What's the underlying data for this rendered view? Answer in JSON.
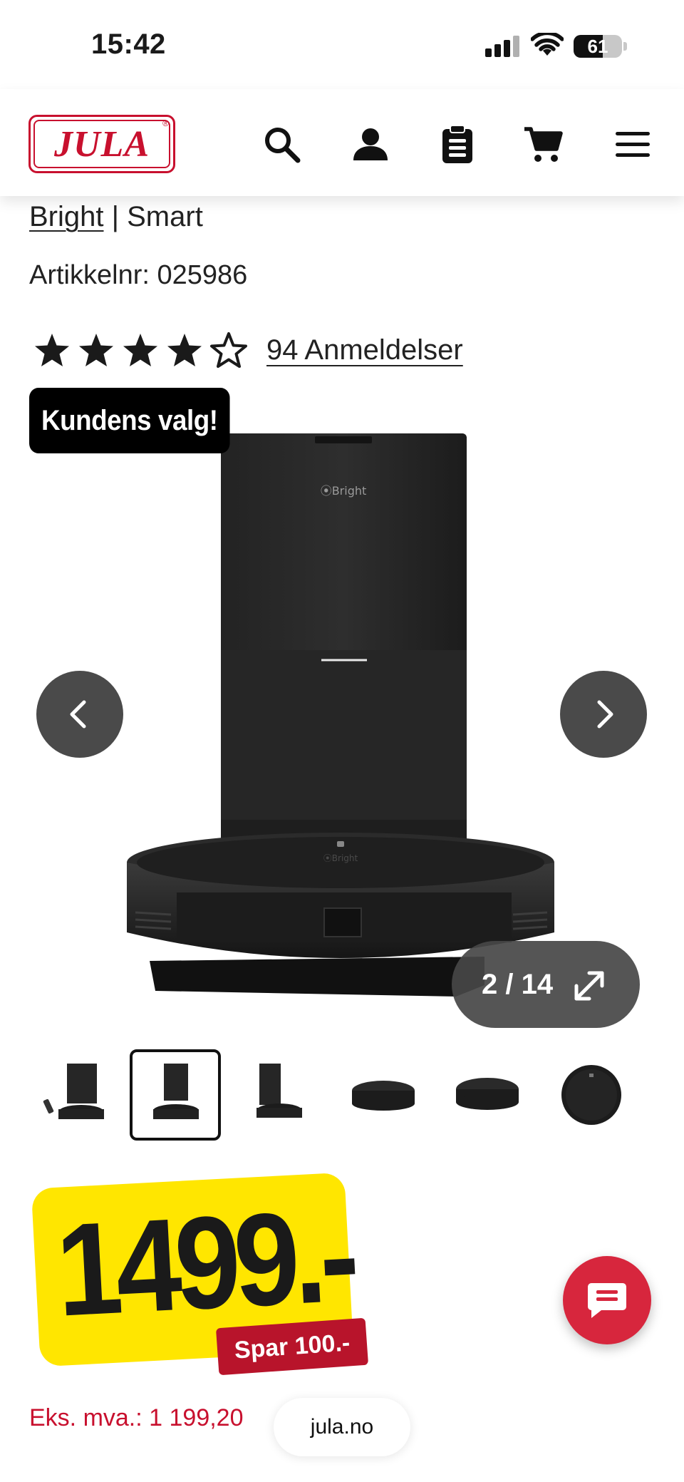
{
  "status_bar": {
    "time": "15:42",
    "battery_level": "61",
    "battery_fraction": 0.61,
    "icons": [
      "signal-icon",
      "wifi-icon",
      "battery-icon"
    ]
  },
  "header": {
    "logo_text": "JULA",
    "icons": [
      "search-icon",
      "account-icon",
      "shopping-list-icon",
      "cart-icon",
      "menu-icon"
    ]
  },
  "product": {
    "brand": "Bright",
    "separator": " | ",
    "category": "Smart",
    "article_label": "Artikkelnr: 025986",
    "rating": 4.5,
    "rating_max": 5,
    "reviews_label": "94 Anmeldelser",
    "badge": "Kundens valg!"
  },
  "gallery": {
    "counter": "2 / 14",
    "current_index": 2,
    "total": 14,
    "thumbnails_visible": 6,
    "active_thumbnail": 2
  },
  "price": {
    "amount": "1499.-",
    "savings": "Spar 100.-",
    "ex_vat": "Eks. mva.: 1 199,20"
  },
  "browser": {
    "url": "jula.no"
  },
  "colors": {
    "brand_red": "#c8102e",
    "price_yellow": "#ffe600",
    "save_red": "#b8142b",
    "chat_red": "#d7263d",
    "overlay_gray": "#4a4a4a"
  }
}
